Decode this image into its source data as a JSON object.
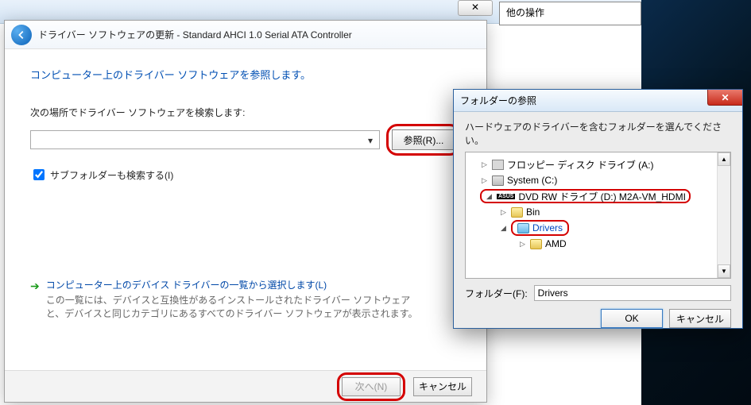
{
  "background": {
    "other_ops": "他の操作",
    "close_x": "✕"
  },
  "wizard": {
    "title": "ドライバー ソフトウェアの更新 - Standard AHCI 1.0 Serial ATA Controller",
    "heading": "コンピューター上のドライバー ソフトウェアを参照します。",
    "search_label": "次の場所でドライバー ソフトウェアを検索します:",
    "path_value": "",
    "browse_label": "参照(R)...",
    "subfolders_label": "サブフォルダーも検索する(I)",
    "pick_link": "コンピューター上のデバイス ドライバーの一覧から選択します(L)",
    "pick_desc": "この一覧には、デバイスと互換性があるインストールされたドライバー ソフトウェアと、デバイスと同じカテゴリにあるすべてのドライバー ソフトウェアが表示されます。",
    "next_label": "次へ(N)",
    "cancel_label": "キャンセル"
  },
  "folder_dialog": {
    "title": "フォルダーの参照",
    "message": "ハードウェアのドライバーを含むフォルダーを選んでください。",
    "tree": {
      "floppy": "フロッピー ディスク ドライブ (A:)",
      "system": "System (C:)",
      "asus_badge": "ASUS",
      "dvd": "DVD RW ドライブ (D:) M2A-VM_HDMI",
      "bin": "Bin",
      "drivers": "Drivers",
      "amd": "AMD"
    },
    "field_label": "フォルダー(F):",
    "field_value": "Drivers",
    "ok_label": "OK",
    "cancel_label": "キャンセル"
  }
}
